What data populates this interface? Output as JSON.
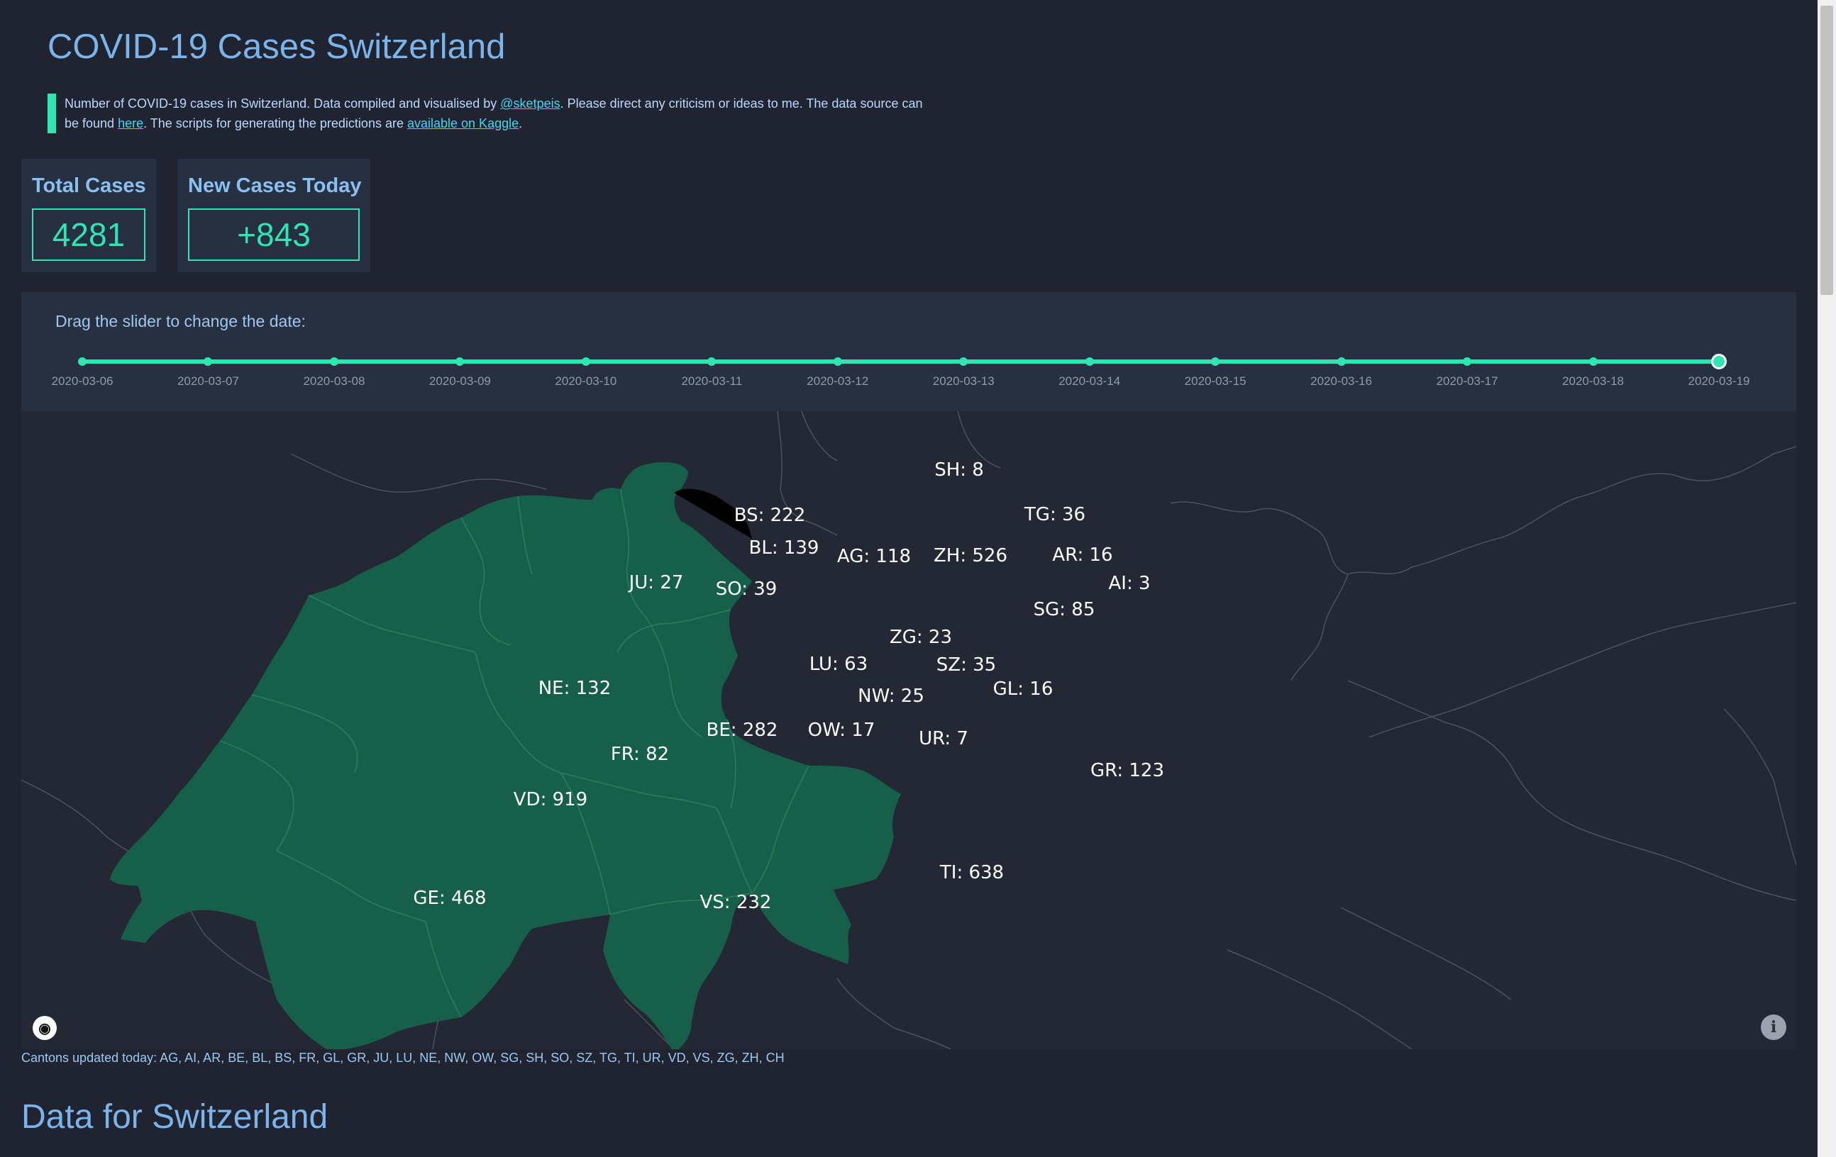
{
  "header": {
    "title": "COVID-19 Cases Switzerland",
    "desc_1": "Number of COVID-19 cases in Switzerland. Data compiled and visualised by ",
    "desc_link_author": "@sketpeis",
    "desc_2": ". Please direct any criticism or ideas to me. The data source can be found ",
    "desc_link_here": "here",
    "desc_3": ". The scripts for generating the predictions are ",
    "desc_link_kaggle": "available on Kaggle",
    "desc_4": "."
  },
  "stats": {
    "total_label": "Total Cases",
    "total_value": "4281",
    "new_label": "New Cases Today",
    "new_value": "+843"
  },
  "slider": {
    "label": "Drag the slider to change the date:",
    "dates": [
      "2020-03-06",
      "2020-03-07",
      "2020-03-08",
      "2020-03-09",
      "2020-03-10",
      "2020-03-11",
      "2020-03-12",
      "2020-03-13",
      "2020-03-14",
      "2020-03-15",
      "2020-03-16",
      "2020-03-17",
      "2020-03-18",
      "2020-03-19"
    ],
    "selected_index": 13
  },
  "map": {
    "canton_fill": "#165f48",
    "cantons": [
      {
        "code": "SH",
        "cases": 8
      },
      {
        "code": "BS",
        "cases": 222
      },
      {
        "code": "TG",
        "cases": 36
      },
      {
        "code": "BL",
        "cases": 139
      },
      {
        "code": "AG",
        "cases": 118
      },
      {
        "code": "ZH",
        "cases": 526
      },
      {
        "code": "AR",
        "cases": 16
      },
      {
        "code": "JU",
        "cases": 27
      },
      {
        "code": "AI",
        "cases": 3
      },
      {
        "code": "SO",
        "cases": 39
      },
      {
        "code": "SG",
        "cases": 85
      },
      {
        "code": "ZG",
        "cases": 23
      },
      {
        "code": "LU",
        "cases": 63
      },
      {
        "code": "SZ",
        "cases": 35
      },
      {
        "code": "NE",
        "cases": 132
      },
      {
        "code": "GL",
        "cases": 16
      },
      {
        "code": "NW",
        "cases": 25
      },
      {
        "code": "BE",
        "cases": 282
      },
      {
        "code": "OW",
        "cases": 17
      },
      {
        "code": "UR",
        "cases": 7
      },
      {
        "code": "FR",
        "cases": 82
      },
      {
        "code": "GR",
        "cases": 123
      },
      {
        "code": "VD",
        "cases": 919
      },
      {
        "code": "TI",
        "cases": 638
      },
      {
        "code": "GE",
        "cases": 468
      },
      {
        "code": "VS",
        "cases": 232
      }
    ]
  },
  "footer": {
    "updated": "Cantons updated today: AG, AI, AR, BE, BL, BS, FR, GL, GR, JU, LU, NE, NW, OW, SG, SH, SO, SZ, TG, TI, UR, VD, VS, ZG, ZH, CH",
    "section_title": "Data for Switzerland"
  }
}
